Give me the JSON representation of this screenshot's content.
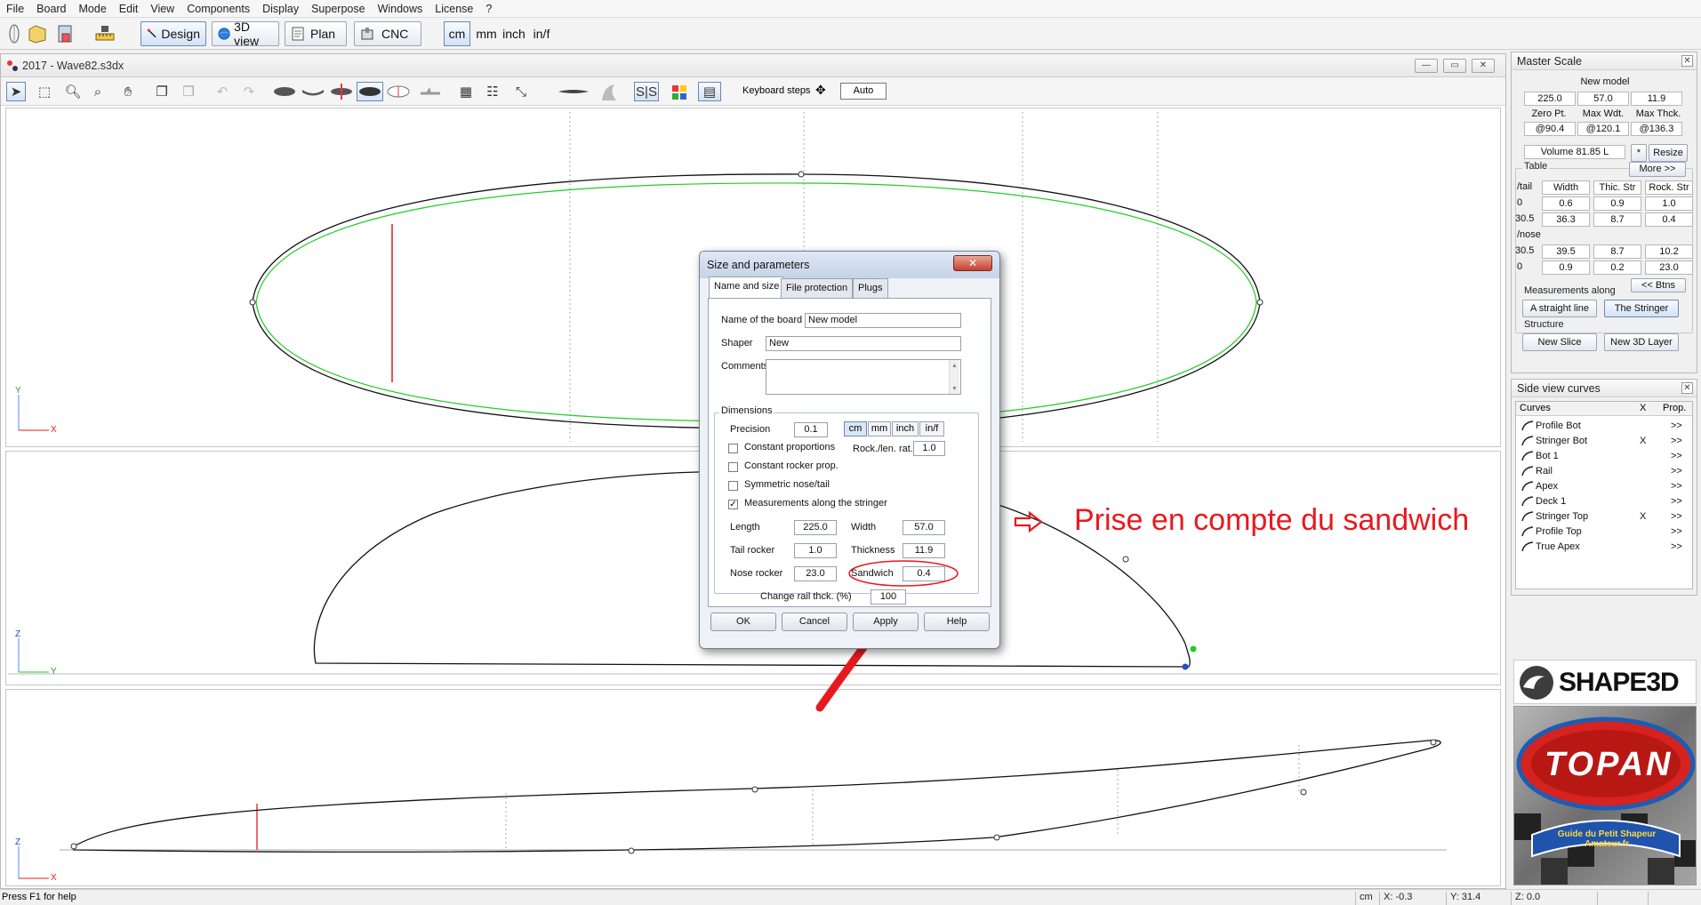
{
  "menu": [
    "File",
    "Board",
    "Mode",
    "Edit",
    "View",
    "Components",
    "Display",
    "Superpose",
    "Windows",
    "License",
    "?"
  ],
  "toolbar": {
    "design_label": "Design",
    "view3d_label": "3D view",
    "plan_label": "Plan",
    "cnc_label": "CNC",
    "units": [
      "cm",
      "mm",
      "inch",
      "in/f"
    ],
    "active_unit": "cm"
  },
  "document": {
    "title": "2017 - Wave82.s3dx",
    "keyboard_steps_label": "Keyboard steps",
    "auto_label": "Auto"
  },
  "views": {
    "top": {
      "axis_v": "Y",
      "axis_h": "X"
    },
    "side": {
      "axis_v": "Z",
      "axis_h": "Y"
    },
    "bottom": {
      "axis_v": "Z",
      "axis_h": "X"
    }
  },
  "master_scale": {
    "title": "Master Scale",
    "model_name": "New model",
    "dims": [
      "225.0",
      "57.0",
      "11.9"
    ],
    "labels": [
      "Zero Pt.",
      "Max Wdt.",
      "Max Thck."
    ],
    "positions": [
      "@90.4",
      "@120.1",
      "@136.3"
    ],
    "volume": "Volume 81.85 L",
    "star_btn": "*",
    "resize_btn": "Resize",
    "table_label": "Table",
    "more_btn": "More >>",
    "col_tail": "/tail",
    "col_width": "Width",
    "col_thic": "Thic. Str",
    "col_rock": "Rock. Str",
    "tail_rows": [
      [
        "0",
        "0.6",
        "0.9",
        "1.0"
      ],
      [
        "30.5",
        "36.3",
        "8.7",
        "0.4"
      ]
    ],
    "nose_label": "/nose",
    "nose_rows": [
      [
        "30.5",
        "39.5",
        "8.7",
        "10.2"
      ],
      [
        "0",
        "0.9",
        "0.2",
        "23.0"
      ]
    ],
    "btns_btn": "<< Btns",
    "measurements_label": "Measurements along",
    "straight_btn": "A straight line",
    "stringer_btn": "The Stringer",
    "structure_label": "Structure",
    "new_slice_btn": "New Slice",
    "new_3d_layer_btn": "New 3D Layer"
  },
  "side_curves": {
    "title": "Side view curves",
    "col_curves": "Curves",
    "col_x": "X",
    "col_prop": "Prop.",
    "rows": [
      {
        "name": "Profile Bot",
        "x": "",
        "prop": ">>"
      },
      {
        "name": "Stringer Bot",
        "x": "X",
        "prop": ">>"
      },
      {
        "name": "Bot 1",
        "x": "",
        "prop": ">>"
      },
      {
        "name": "Rail",
        "x": "",
        "prop": ">>"
      },
      {
        "name": "Apex",
        "x": "",
        "prop": ">>"
      },
      {
        "name": "Deck 1",
        "x": "",
        "prop": ">>"
      },
      {
        "name": "Stringer Top",
        "x": "X",
        "prop": ">>"
      },
      {
        "name": "Profile Top",
        "x": "",
        "prop": ">>"
      },
      {
        "name": "True Apex",
        "x": "",
        "prop": ">>"
      }
    ]
  },
  "logos": {
    "shape3d": "SHAPE3D",
    "topan": "TOPAN",
    "guide": "Guide du Petit Shapeur Amateur.fr"
  },
  "dialog": {
    "title": "Size and parameters",
    "close_label": "✕",
    "tabs": [
      "Name and size",
      "File protection",
      "Plugs"
    ],
    "name_label": "Name of the board",
    "name_value": "New model",
    "shaper_label": "Shaper",
    "shaper_value": "New",
    "comments_label": "Comments",
    "dimensions_label": "Dimensions",
    "precision_label": "Precision",
    "precision_value": "0.1",
    "units": [
      "cm",
      "mm",
      "inch",
      "in/f"
    ],
    "constant_proportions": "Constant proportions",
    "constant_rocker": "Constant rocker prop.",
    "symmetric": "Symmetric nose/tail",
    "measurements_stringer": "Measurements along the stringer",
    "rock_len_label": "Rock./len. rat.",
    "rock_len_value": "1.0",
    "length_label": "Length",
    "length_value": "225.0",
    "width_label": "Width",
    "width_value": "57.0",
    "tail_rocker_label": "Tail rocker",
    "tail_rocker_value": "1.0",
    "thickness_label": "Thickness",
    "thickness_value": "11.9",
    "nose_rocker_label": "Nose rocker",
    "nose_rocker_value": "23.0",
    "sandwich_label": "Sandwich",
    "sandwich_value": "0.4",
    "rail_label": "Change rail thck. (%)",
    "rail_value": "100",
    "ok": "OK",
    "cancel": "Cancel",
    "apply": "Apply",
    "help": "Help"
  },
  "annotation": "Prise en compte du sandwich",
  "status": {
    "help": "Press F1 for help",
    "unit": "cm",
    "x": "X: -0.3",
    "y": "Y: 31.4",
    "z": "Z: 0.0"
  },
  "colors": {
    "outline": "#000000",
    "green_curve": "#22cc22",
    "red_marker": "#e8191e",
    "axis": "#4c8ce8"
  }
}
